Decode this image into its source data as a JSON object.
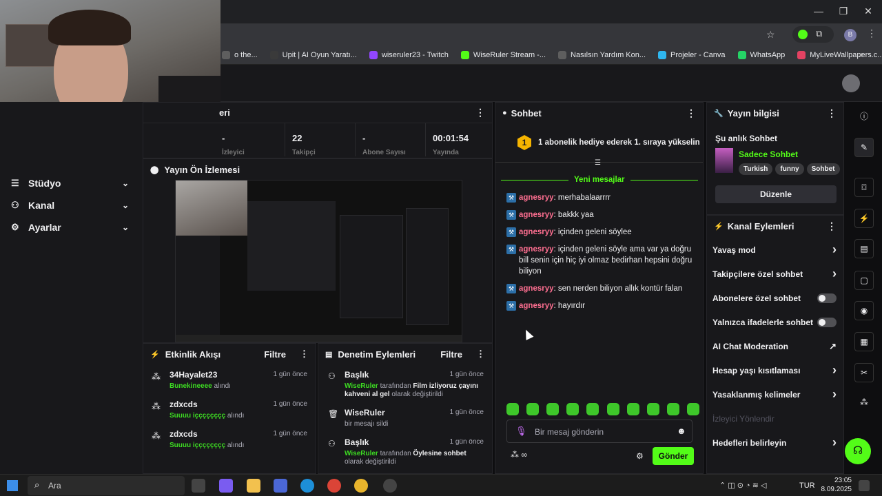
{
  "browser": {
    "bookmarks": [
      {
        "label": "o the...",
        "color": "#5e5e5e"
      },
      {
        "label": "Upit | AI Oyun Yaratı...",
        "color": "#3a3a3a"
      },
      {
        "label": "wiseruler23 - Twitch",
        "color": "#9146ff"
      },
      {
        "label": "WiseRuler Stream -...",
        "color": "#53fc18"
      },
      {
        "label": "Nasılsın Yardım Kon...",
        "color": "#5e5e5e"
      },
      {
        "label": "Projeler - Canva",
        "color": "#2fb7ef"
      },
      {
        "label": "WhatsApp",
        "color": "#25d366"
      },
      {
        "label": "MyLiveWallpapers.c...",
        "color": "#e34262"
      }
    ],
    "profile_initial": "B"
  },
  "sidebar": {
    "items": [
      {
        "label": "Stüdyo"
      },
      {
        "label": "Kanal"
      },
      {
        "label": "Ayarlar"
      }
    ]
  },
  "stats": {
    "header_fragment": "eri",
    "items": [
      {
        "value": "-",
        "label": "İzleyici"
      },
      {
        "value": "22",
        "label": "Takipçi"
      },
      {
        "value": "-",
        "label": "Abone Sayısı"
      },
      {
        "value": "00:01:54",
        "label": "Yayında"
      }
    ]
  },
  "preview": {
    "title": "Yayın Ön İzlemesi"
  },
  "activity": {
    "title": "Etkinlik Akışı",
    "filter": "Filtre",
    "events": [
      {
        "name": "34Hayalet23",
        "time": "1 gün önce",
        "highlight": "Bunekineeee",
        "text": " alındı"
      },
      {
        "name": "zdxcds",
        "time": "1 gün önce",
        "highlight": "Suuuu içççççççç",
        "text": " alındı"
      },
      {
        "name": "zdxcds",
        "time": "1 gün önce",
        "highlight": "Suuuu içççççççç",
        "text": " alındı"
      }
    ]
  },
  "moderation": {
    "title": "Denetim Eylemleri",
    "filter": "Filtre",
    "events": [
      {
        "name": "Başlık",
        "time": "1 gün önce",
        "user": "WiseRuler",
        "mid": " tarafından ",
        "value": "Film izliyoruz çayını kahveni al gel",
        "end": " olarak değiştirildi"
      },
      {
        "name": "WiseRuler",
        "time": "1 gün önce",
        "user": "",
        "mid": "bir mesajı sildi",
        "value": "",
        "end": ""
      },
      {
        "name": "Başlık",
        "time": "1 gün önce",
        "user": "WiseRuler",
        "mid": " tarafından ",
        "value": "Öylesine sohbet",
        "end": " olarak değiştirildi"
      }
    ]
  },
  "chat": {
    "title": "Sohbet",
    "gift_rank": "1",
    "gift_text": "1 abonelik hediye ederek 1. sıraya yükselin",
    "new_messages": "Yeni mesajlar",
    "messages": [
      {
        "user": "agnesryy",
        "text": ": merhabalaarrrr"
      },
      {
        "user": "agnesryy",
        "text": ": bakkk yaa"
      },
      {
        "user": "agnesryy",
        "text": ": içinden geleni söylee"
      },
      {
        "user": "agnesryy",
        "text": ": içinden geleni söyle ama var ya doğru bill senin için hiç iyi olmaz bedirhan hepsini doğru biliyon"
      },
      {
        "user": "agnesryy",
        "text": ": sen nerden biliyon allık kontür falan"
      },
      {
        "user": "agnesryy",
        "text": ": hayırdır"
      }
    ],
    "placeholder": "Bir mesaj gönderin",
    "send": "Gönder",
    "points": "∞"
  },
  "stream_info": {
    "title": "Yayın bilgisi",
    "now": "Şu anlık Sohbet",
    "category": "Sadece Sohbet",
    "tags": [
      "Turkish",
      "funny",
      "Sohbet"
    ],
    "edit": "Düzenle"
  },
  "channel_actions": {
    "title": "Kanal Eylemleri",
    "items": [
      {
        "label": "Yavaş mod",
        "kind": "arrow"
      },
      {
        "label": "Takipçilere özel sohbet",
        "kind": "arrow"
      },
      {
        "label": "Abonelere özel sohbet",
        "kind": "toggle"
      },
      {
        "label": "Yalnızca ifadelerle sohbet",
        "kind": "toggle"
      },
      {
        "label": "AI Chat Moderation",
        "kind": "ext"
      },
      {
        "label": "Hesap yaşı kısıtlaması",
        "kind": "arrow"
      },
      {
        "label": "Yasaklanmış kelimeler",
        "kind": "arrow"
      },
      {
        "label": "İzleyici Yönlendir",
        "kind": "disabled"
      },
      {
        "label": "Hedefleri belirleyin",
        "kind": "arrow"
      }
    ]
  },
  "taskbar": {
    "search": "Ara",
    "lang": "TUR",
    "time": "23:05",
    "date": "8.09.2025"
  },
  "colors": {
    "accent": "#53fc18",
    "bg": "#0e0e10",
    "panel": "#18181b"
  }
}
